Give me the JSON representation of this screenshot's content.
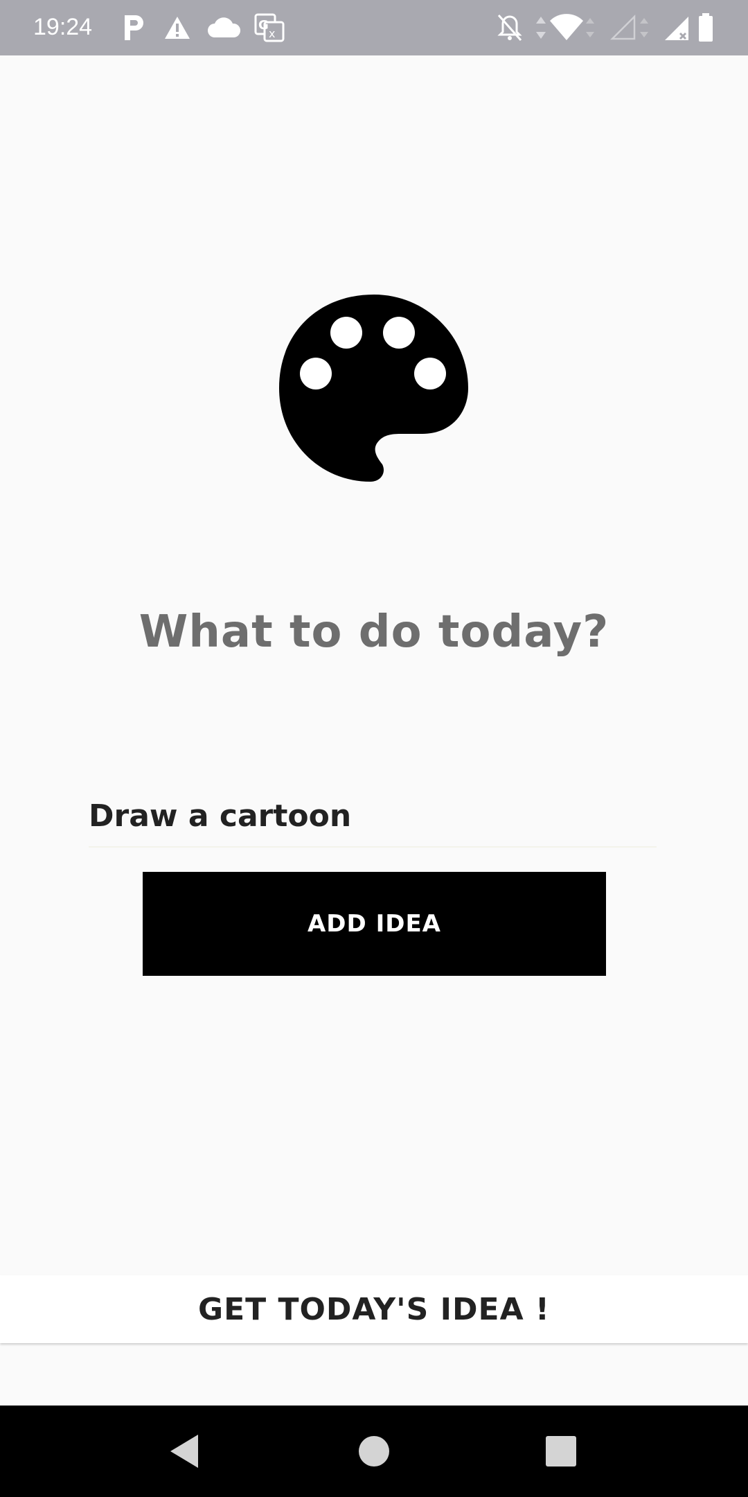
{
  "status_bar": {
    "time": "19:24",
    "icons": [
      "parking-icon",
      "warning-icon",
      "cloud-icon",
      "translate-icon",
      "notifications-off-icon",
      "data-arrows-icon",
      "wifi-icon",
      "signal-empty-icon",
      "signal-icon",
      "battery-icon"
    ]
  },
  "main": {
    "logo_icon": "palette-icon",
    "headline": "What to do today?",
    "idea_input": {
      "value": "Draw a cartoon",
      "placeholder": ""
    },
    "add_button_label": "ADD IDEA",
    "get_idea_label": "GET TODAY'S IDEA !"
  },
  "nav_bar": {
    "buttons": [
      "back-icon",
      "home-icon",
      "recents-icon"
    ]
  },
  "colors": {
    "status_bar": "#a9a9b0",
    "background": "#fafafa",
    "headline": "#6e6e6e",
    "button": "#000000",
    "button_text": "#ffffff",
    "nav_bar": "#000000"
  }
}
